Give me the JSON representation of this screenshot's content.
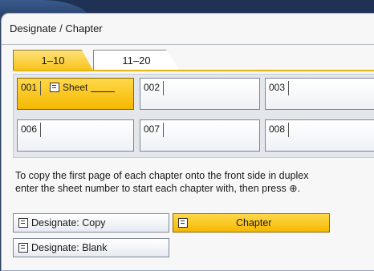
{
  "window": {
    "title": "Designate / Chapter"
  },
  "tabs": [
    {
      "label": "1–10",
      "active": true
    },
    {
      "label": "11–20",
      "active": false
    }
  ],
  "cells": [
    {
      "num": "001",
      "label": "Sheet",
      "active": true
    },
    {
      "num": "002",
      "label": ""
    },
    {
      "num": "003",
      "label": ""
    },
    {
      "num": "006",
      "label": ""
    },
    {
      "num": "007",
      "label": ""
    },
    {
      "num": "008",
      "label": ""
    }
  ],
  "instruction": {
    "line1": "To copy the first page of each chapter onto the front side in duplex",
    "line2": "enter the sheet number to start each chapter with, then press ⊕."
  },
  "buttons": {
    "designate_copy": "Designate: Copy",
    "chapter": "Chapter",
    "designate_blank": "Designate: Blank"
  },
  "colors": {
    "accent": "#f5b800",
    "panel": "#f7f7f7",
    "frame": "#2d3f60"
  }
}
